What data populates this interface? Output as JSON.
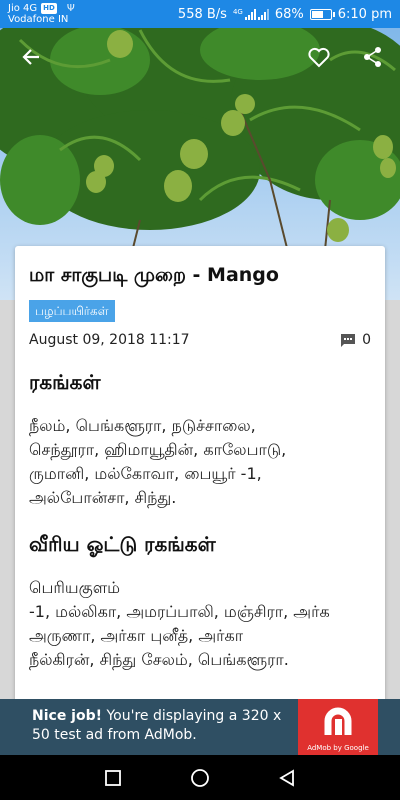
{
  "status_bar": {
    "carrier_line1": "Jio 4G",
    "carrier_badge": "HD",
    "carrier_line2": "Vodafone IN",
    "net_speed": "558 B/s",
    "net_type": "4G",
    "battery_text": "68%",
    "battery_level": 0.68,
    "time": "6:10 pm"
  },
  "app_bar": {
    "icons": [
      "back-arrow-icon",
      "heart-icon",
      "share-icon"
    ]
  },
  "article": {
    "title": "மா சாகுபடி முறை - Mango",
    "category": "பழப்பயிர்கள்",
    "date": "August 09, 2018 11:17",
    "comment_count": "0",
    "section1_heading": "ரகங்கள்",
    "section1_text": "நீலம், பெங்களூரா, நடுச்சாலை,\nசெந்தூரா, ஹிமாயூதின், காலேபாடு,\nருமானி, மல்கோவா, பையூர் -1,\nஅல்போன்சா, சிந்து.",
    "section2_heading": "வீரிய ஓட்டு ரகங்கள்",
    "section2_text": "பெரியகுளம்\n-1, மல்லிகா, அமரப்பாலி, மஞ்சிரா, அர்க\nஅருணா, அர்கா புனீத், அர்கா\nநீல்கிரன், சிந்து சேலம், பெங்களூரா."
  },
  "ad": {
    "bold_text": "Nice job!",
    "text": " You're displaying a 320 x 50 test ad from AdMob.",
    "logo_caption": "AdMob by Google"
  },
  "colors": {
    "status_bar": "#1e88e5",
    "category_badge": "#4aa3e8",
    "ad_background": "#2f4f63",
    "ad_logo": "#e0312f"
  }
}
